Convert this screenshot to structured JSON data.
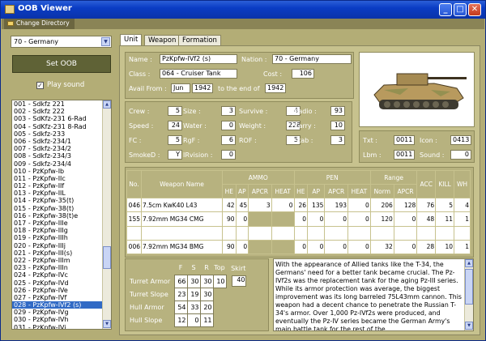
{
  "window": {
    "title": "OOB Viewer"
  },
  "menu": {
    "change_directory": "Change Directory"
  },
  "left": {
    "nation_select": "70 - Germany",
    "set_oob": "Set OOB",
    "play_sound": "Play sound",
    "units": [
      "001 - Sdkfz 221",
      "002 - Sdkfz 222",
      "003 - SdKfz-231 6-Rad",
      "004 - SdKfz-231 8-Rad",
      "005 - Sdkfz-233",
      "006 - Sdkfz-234/1",
      "007 - Sdkfz-234/2",
      "008 - Sdkfz-234/3",
      "009 - Sdkfz-234/4",
      "010 - PzKpfw-Ib",
      "011 - PzKpfw-IIc",
      "012 - PzKpfw-IIf",
      "013 - PzKpfw-IIL",
      "014 - PzKpfw-35(t)",
      "015 - PzKpfw-38(t)",
      "016 - PzKpfw-38(t)e",
      "017 - PzKpfw-IIIe",
      "018 - PzKpfw-IIIg",
      "019 - PzKpfw-IIIh",
      "020 - PzKpfw-IIIj",
      "021 - PzKpfw-III(s)",
      "022 - PzKpfw-IIIm",
      "023 - PzKpfw-IIIn",
      "024 - PzKpfw-IVc",
      "025 - PzKpfw-IVd",
      "026 - PzKpfw-IVe",
      "027 - PzKpfw-IVf",
      "028 - PzKpfw-IVf2 (s)",
      "029 - PzKpfw-IVg",
      "030 - PzKpfw-IVh",
      "031 - PzKpfw-IVj"
    ],
    "selected_index": 27
  },
  "tabs": [
    "Unit",
    "Weapon",
    "Formation"
  ],
  "unit": {
    "name_label": "Name :",
    "name": "PzKpfw-IVf2 (s)",
    "nation_label": "Nation :",
    "nation": "70 - Germany",
    "class_label": "Class :",
    "class": "064 - Cruiser Tank",
    "cost_label": "Cost :",
    "cost": "106",
    "avail_label": "Avail From :",
    "avail_month": "Jun",
    "avail_year": "1942",
    "end_label": "to the end of",
    "end_year": "1942"
  },
  "stats": [
    [
      {
        "l": "Crew :",
        "v": "5"
      },
      {
        "l": "Size :",
        "v": "3"
      },
      {
        "l": "Survive :",
        "v": "4"
      },
      {
        "l": "Radio :",
        "v": "93"
      }
    ],
    [
      {
        "l": "Speed :",
        "v": "24"
      },
      {
        "l": "Water :",
        "v": "0"
      },
      {
        "l": "Weight :",
        "v": "228"
      },
      {
        "l": "Carry :",
        "v": "10"
      }
    ],
    [
      {
        "l": "FC :",
        "v": "5"
      },
      {
        "l": "RgF :",
        "v": "6"
      },
      {
        "l": "ROF :",
        "v": "5"
      },
      {
        "l": "Stab :",
        "v": "3"
      }
    ],
    [
      {
        "l": "SmokeD :",
        "v": "Y"
      },
      {
        "l": "IRvision :",
        "v": "0"
      }
    ]
  ],
  "misc": {
    "txt_label": "Txt :",
    "txt": "0011",
    "icon_label": "Icon :",
    "icon": "0413",
    "lbm_label": "Lbm :",
    "lbm": "0011",
    "sound_label": "Sound :",
    "sound": "0"
  },
  "weapons": {
    "headers": {
      "no": "No.",
      "name": "Weapon Name",
      "ammo": "AMMO",
      "pen": "PEN",
      "range": "Range",
      "acc": "ACC",
      "kill": "KILL",
      "wh": "WH",
      "ammo_sub": [
        "HE",
        "AP",
        "APCR",
        "HEAT"
      ],
      "pen_sub": [
        "HE",
        "AP",
        "APCR",
        "HEAT"
      ],
      "range_sub": [
        "Norm",
        "APCR"
      ]
    },
    "rows": [
      [
        "046",
        "7.5cm KwK40 L43",
        "42",
        "45",
        "3",
        "0",
        "26",
        "135",
        "193",
        "0",
        "206",
        "128",
        "76",
        "5",
        "4"
      ],
      [
        "155",
        "7.92mm MG34 CMG",
        "90",
        "0",
        "",
        "",
        "0",
        "0",
        "0",
        "0",
        "120",
        "0",
        "48",
        "11",
        "1"
      ],
      [
        "",
        "",
        "",
        "",
        "",
        "",
        "",
        "",
        "",
        "",
        "",
        "",
        "",
        "",
        ""
      ],
      [
        "006",
        "7.92mm MG34 BMG",
        "90",
        "0",
        "",
        "",
        "0",
        "0",
        "0",
        "0",
        "32",
        "0",
        "28",
        "10",
        "1"
      ]
    ]
  },
  "armor": {
    "headers": [
      "F",
      "S",
      "R",
      "Top",
      "Skirt"
    ],
    "turret_armor_label": "Turret Armor",
    "turret_armor": [
      "66",
      "30",
      "30",
      "10"
    ],
    "skirt": "40",
    "turret_slope_label": "Turret Slope",
    "turret_slope": [
      "23",
      "19",
      "30"
    ],
    "hull_armor_label": "Hull Armor",
    "hull_armor": [
      "54",
      "33",
      "20"
    ],
    "hull_slope_label": "Hull Slope",
    "hull_slope": [
      "12",
      "0",
      "11"
    ]
  },
  "description": "With the appearance of Allied tanks like the T-34, the Germans' need for a better tank became crucial. The Pz-IVf2s was the replacement tank for the aging Pz-III series. While its armor protection was average, the biggest improvement was its long barreled 75L43mm cannon. This weapon had a decent chance to penetrate the Russian T-34's armor. Over 1,000 Pz-IVf2s were produced, and eventually the Pz-IV series became the German Army's main battle tank for the rest of the"
}
